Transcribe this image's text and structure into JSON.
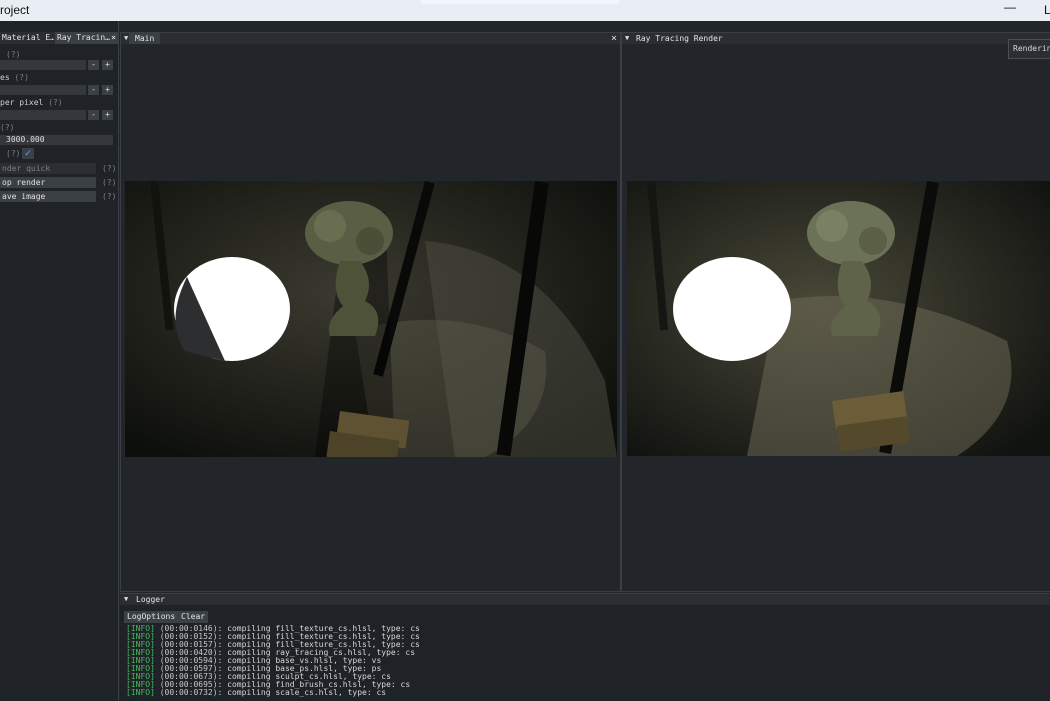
{
  "window": {
    "title": "roject",
    "minimize": "—",
    "maximize": "L"
  },
  "left_panel": {
    "tabs": [
      {
        "label": "Material E…"
      },
      {
        "label": "Ray Tracin…",
        "close": "×"
      }
    ],
    "help_mark": "(?)",
    "rows": [
      {
        "label": "",
        "value": ""
      },
      {
        "label": "es",
        "value": ""
      },
      {
        "label": "per pixel",
        "value": ""
      },
      {
        "label": "",
        "value": "3000.000"
      }
    ],
    "checkbox_checked": true,
    "buttons": [
      {
        "label": "nder quick",
        "disabled": true
      },
      {
        "label": "op render",
        "disabled": false
      },
      {
        "label": "ave image",
        "disabled": false
      }
    ],
    "stepper": {
      "minus": "-",
      "plus": "+"
    }
  },
  "main_view": {
    "tab": "Main",
    "close": "×",
    "menu_glyph": "▼"
  },
  "rt_view": {
    "tab": "Ray Tracing Render",
    "menu_glyph": "▼",
    "tooltip": "Rendering"
  },
  "logger": {
    "title": "Logger",
    "buttons": {
      "options": "LogOptions",
      "clear": "Clear"
    },
    "lines": [
      {
        "level": "[INFO]",
        "time": "(00:00:0146)",
        "text": ": compiling fill_texture_cs.hlsl, type: cs"
      },
      {
        "level": "[INFO]",
        "time": "(00:00:0152)",
        "text": ": compiling fill_texture_cs.hlsl, type: cs"
      },
      {
        "level": "[INFO]",
        "time": "(00:00:0157)",
        "text": ": compiling fill_texture_cs.hlsl, type: cs"
      },
      {
        "level": "[INFO]",
        "time": "(00:00:0420)",
        "text": ": compiling ray_tracing_cs.hlsl, type: cs"
      },
      {
        "level": "[INFO]",
        "time": "(00:00:0594)",
        "text": ": compiling base_vs.hlsl, type: vs"
      },
      {
        "level": "[INFO]",
        "time": "(00:00:0597)",
        "text": ": compiling base_ps.hlsl, type: ps"
      },
      {
        "level": "[INFO]",
        "time": "(00:00:0673)",
        "text": ": compiling sculpt_cs.hlsl, type: cs"
      },
      {
        "level": "[INFO]",
        "time": "(00:00:0695)",
        "text": ": compiling find_brush_cs.hlsl, type: cs"
      },
      {
        "level": "[INFO]",
        "time": "(00:00:0732)",
        "text": ": compiling scale_cs.hlsl, type: cs"
      }
    ]
  },
  "colors": {
    "background": "#22262b",
    "panel": "#1f2226",
    "accent": "#5ea0ff",
    "log_level": "#3fbf5f"
  }
}
